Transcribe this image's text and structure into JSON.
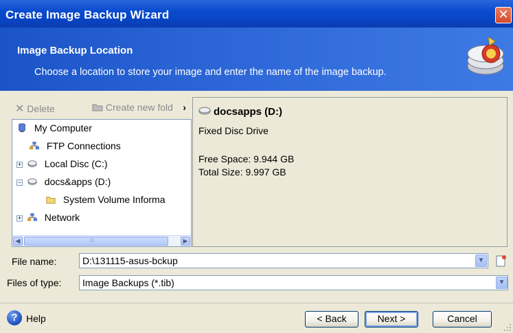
{
  "window": {
    "title": "Create Image Backup Wizard",
    "close_glyph": "✕"
  },
  "header": {
    "title": "Image Backup Location",
    "subtitle": "Choose a location to store your image and enter the name of the image backup."
  },
  "toolbar": {
    "delete_label": "Delete",
    "create_folder_label": "Create new fold",
    "more_glyph": "›"
  },
  "tree": {
    "items": [
      {
        "label": "My Computer",
        "icon": "computer-icon"
      },
      {
        "label": "FTP Connections",
        "icon": "network-icon"
      },
      {
        "label": "Local Disc (C:)",
        "icon": "drive-icon"
      },
      {
        "label": "docs&apps (D:)",
        "icon": "drive-icon"
      },
      {
        "label": "System Volume Informa",
        "icon": "folder-icon"
      },
      {
        "label": "Network",
        "icon": "network-icon"
      }
    ],
    "expanders": {
      "local_disc": "+",
      "docs_apps": "−",
      "network": "+"
    },
    "scroll": {
      "left_arrow": "◀",
      "right_arrow": "▶",
      "thumb_grip": "III"
    }
  },
  "info": {
    "drive_name": "docsapps (D:)",
    "drive_type": "Fixed Disc Drive",
    "free_space": "Free Space: 9.944 GB",
    "total_size": "Total Size: 9.997 GB"
  },
  "file_name": {
    "label": "File name:",
    "value": "D:\\131115-asus-bckup"
  },
  "file_type": {
    "label": "Files of type:",
    "value": "Image Backups (*.tib)"
  },
  "combo_glyph": "▼",
  "footer": {
    "help_glyph": "?",
    "help_label": "Help",
    "back_label": "< Back",
    "next_label": "Next >",
    "cancel_label": "Cancel"
  },
  "colors": {
    "titlebar": "#0845c4",
    "header": "#2f69d9",
    "dialog_bg": "#ece9d8",
    "close_button": "#d6492a"
  }
}
